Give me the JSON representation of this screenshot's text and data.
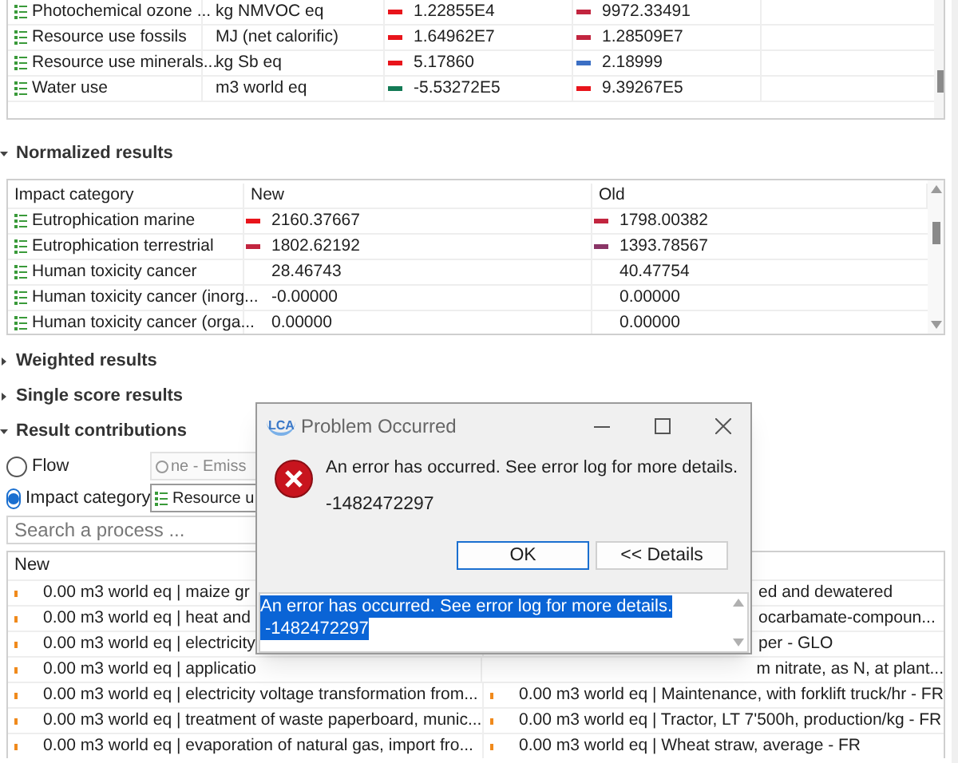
{
  "impact_table": {
    "rows": [
      {
        "name": "Photochemical ozone ...",
        "unit": "kg NMVOC eq",
        "new": {
          "value": "1.22855E4",
          "color": "#e8141b"
        },
        "old": {
          "value": "9972.33491",
          "color": "#c2253f"
        }
      },
      {
        "name": "Resource use fossils",
        "unit": "MJ (net calorific)",
        "new": {
          "value": "1.64962E7",
          "color": "#e8141b"
        },
        "old": {
          "value": "1.28509E7",
          "color": "#c2253f"
        }
      },
      {
        "name": "Resource use minerals...",
        "unit": "kg Sb eq",
        "new": {
          "value": "5.17860",
          "color": "#e8141b"
        },
        "old": {
          "value": "2.18999",
          "color": "#3b6fc4"
        }
      },
      {
        "name": "Water use",
        "unit": "m3 world eq",
        "new": {
          "value": "-5.53272E5",
          "color": "#137a55"
        },
        "old": {
          "value": "9.39267E5",
          "color": "#e8141b"
        }
      }
    ]
  },
  "sections": [
    {
      "title": "Normalized results",
      "expanded": true
    }
  ],
  "normalized_table": {
    "columns": [
      "Impact category",
      "New",
      "Old"
    ],
    "rows": [
      {
        "name": "Eutrophication marine",
        "new": {
          "value": "2160.37667",
          "color": "#e8141b"
        },
        "old": {
          "value": "1798.00382",
          "color": "#c2253f"
        }
      },
      {
        "name": "Eutrophication terrestrial",
        "new": {
          "value": "1802.62192",
          "color": "#c2253f"
        },
        "old": {
          "value": "1393.78567",
          "color": "#8a3566"
        }
      },
      {
        "name": "Human toxicity cancer",
        "new": {
          "value": "28.46743"
        },
        "old": {
          "value": "40.47754"
        }
      },
      {
        "name": "Human toxicity cancer (inorg...",
        "new": {
          "value": "-0.00000"
        },
        "old": {
          "value": "0.00000"
        }
      },
      {
        "name": "Human toxicity cancer (orga...",
        "new": {
          "value": "0.00000"
        },
        "old": {
          "value": "0.00000"
        }
      }
    ]
  },
  "collapsed_sections": [
    {
      "title": "Weighted results",
      "expanded": false
    },
    {
      "title": "Single score results",
      "expanded": false
    },
    {
      "title": "Result contributions",
      "expanded": true
    }
  ],
  "contribution_options": [
    {
      "label": "Flow",
      "selected": false,
      "value": "ne - Emiss"
    },
    {
      "label": "Impact category",
      "selected": true,
      "value": "Resource u"
    }
  ],
  "search": {
    "placeholder": "Search a process ..."
  },
  "contribution_table": {
    "column": "New",
    "rows": [
      {
        "left": "0.00 m3 world eq | maize gr",
        "right": "ed and dewatered"
      },
      {
        "left": "0.00 m3 world eq | heat and",
        "right": "ocarbamate-compoun..."
      },
      {
        "left": "0.00 m3 world eq | electricity",
        "right": "per - GLO"
      },
      {
        "left": "0.00 m3 world eq | applicatio",
        "right": "m nitrate, as N, at plant..."
      },
      {
        "left": "0.00 m3 world eq | electricity voltage transformation from...",
        "right": "0.00 m3 world eq | Maintenance, with forklift truck/hr - FR"
      },
      {
        "left": "0.00 m3 world eq | treatment of waste paperboard, munic...",
        "right": "0.00 m3 world eq | Tractor, LT 7'500h, production/kg - FR"
      },
      {
        "left": "0.00 m3 world eq | evaporation of natural gas, import fro...",
        "right": "0.00 m3 world eq | Wheat straw, average - FR"
      }
    ]
  },
  "dialog": {
    "logo": "LCA",
    "title": "Problem Occurred",
    "message": "An error has occurred. See error log for more details.",
    "code": "-1482472297",
    "buttons": [
      "OK",
      "<< Details"
    ],
    "details": [
      "An error has occurred. See error log for more details.",
      "-1482472297"
    ]
  }
}
